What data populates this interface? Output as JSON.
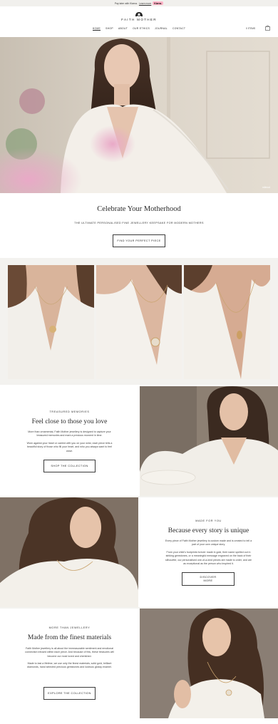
{
  "announcement": {
    "text": "Pay later with Klarna.",
    "link": "Learn more",
    "badge": "Klarna."
  },
  "brand": {
    "name": "FAITH MOTHER"
  },
  "nav": {
    "items": [
      "HOME",
      "SHOP",
      "ABOUT",
      "OUR ETHICS",
      "JOURNAL",
      "CONTACT"
    ],
    "active": "HOME"
  },
  "account": {
    "items_label": "0 ITEMS"
  },
  "hero": {
    "credit": "milmod"
  },
  "intro": {
    "title": "Celebrate Your Motherhood",
    "subtitle": "THE ULTIMATE PERSONALISED FINE JEWELLERY KEEPSAKE FOR MODERN MOTHERS",
    "button": "FIND YOUR PERFECT PIECE"
  },
  "section1": {
    "eyebrow": "TREASURED MEMORIES",
    "title": "Feel close to those you love",
    "p1": "More than ornamental, Faith Mother jewellery is designed to capture your treasured memories and mark a precious moment in time.",
    "p2": "Worn against your heart or carried with you on your wrist, each piece tells a beautiful story of those who fill your heart, and who you always want to feel close.",
    "button": "SHOP THE COLLECTION"
  },
  "section2": {
    "eyebrow": "MADE FOR YOU",
    "title": "Because every story is unique",
    "p1": "Every piece of Faith Mother jewellery is custom made and is created to tell a part of your own unique story.",
    "p2": "From your child's footprints forever made in gold, their name spelled out in striking gemstones, or a meaningful message engraved on the back of their silhouette, our personalised one-of-a-kind pieces are made to order, and are as exceptional as the person who inspired it.",
    "button": "DISCOVER MORE"
  },
  "section3": {
    "eyebrow": "MORE THAN JEWELLERY",
    "title": "Made from the finest materials",
    "p1": "Faith Mother jewellery is all about the immeasurable sentiment and emotional connection infused within each piece. And because of this, these treasures will become our most loved and cherished.",
    "p2": "Made to last a lifetime, we use only the finest materials; solid gold, brilliant diamonds, hand selected precious gemstones and lustrous glossy enamel.",
    "button": "EXPLORE THE COLLECTION"
  },
  "colors": {
    "accent_pink": "#ffb3c7",
    "band_grey": "#f3f2ef",
    "text": "#2b2b2b"
  },
  "icons": [
    "faith-mother-logo-icon",
    "user-icon",
    "bag-icon"
  ]
}
